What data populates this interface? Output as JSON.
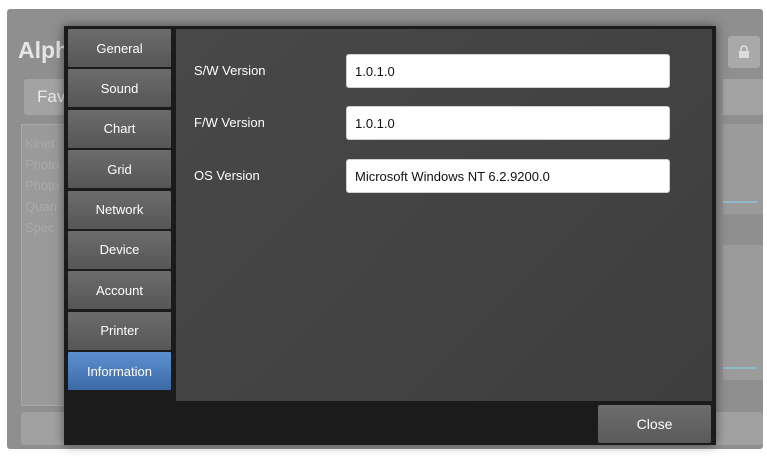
{
  "background_app": {
    "title": "Alph",
    "favorites_tab": "Fav",
    "list_items": [
      "Kinet",
      "Photo",
      "Photo",
      "Quan",
      "Spec"
    ],
    "lock_icon": "lock-icon"
  },
  "dialog": {
    "sidebar": {
      "items": [
        {
          "label": "General"
        },
        {
          "label": "Sound"
        },
        {
          "label": "Chart"
        },
        {
          "label": "Grid"
        },
        {
          "label": "Network"
        },
        {
          "label": "Device"
        },
        {
          "label": "Account"
        },
        {
          "label": "Printer"
        },
        {
          "label": "Information",
          "active": true
        }
      ]
    },
    "info": {
      "sw_label": "S/W Version",
      "sw_value": "1.0.1.0",
      "fw_label": "F/W Version",
      "fw_value": "1.0.1.0",
      "os_label": "OS Version",
      "os_value": "Microsoft Windows NT 6.2.9200.0"
    },
    "close_label": "Close"
  },
  "colors": {
    "active_tab": "#4a7cc0",
    "dialog_bg": "#1b1b1b",
    "content_bg": "#444444"
  }
}
